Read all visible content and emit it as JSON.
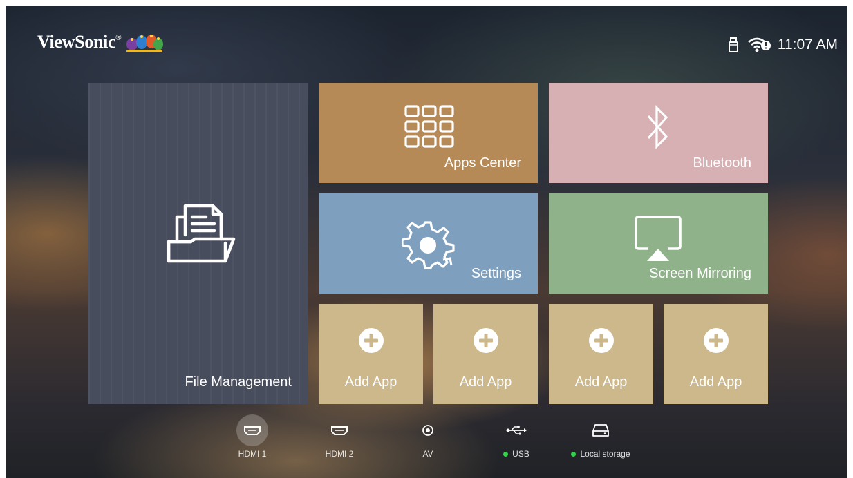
{
  "brand": {
    "name": "ViewSonic",
    "trademark": "®"
  },
  "status": {
    "time": "11:07 AM",
    "icons": [
      "usb-stick-icon",
      "wifi-alert-icon"
    ]
  },
  "tiles": {
    "file_management": {
      "label": "File Management",
      "icon": "folder-document-icon",
      "color": "#484d5d"
    },
    "apps_center": {
      "label": "Apps Center",
      "icon": "grid-icon",
      "color": "#b58a57"
    },
    "bluetooth": {
      "label": "Bluetooth",
      "icon": "bluetooth-icon",
      "color": "#d7b0b4"
    },
    "settings": {
      "label": "Settings",
      "icon": "gear-icon",
      "color": "#7f9fbf"
    },
    "screen_mirroring": {
      "label": "Screen Mirroring",
      "icon": "airplay-icon",
      "color": "#8fb28a"
    },
    "add_apps": [
      {
        "label": "Add App"
      },
      {
        "label": "Add App"
      },
      {
        "label": "Add App"
      },
      {
        "label": "Add App"
      }
    ]
  },
  "inputs": [
    {
      "label": "HDMI 1",
      "icon": "hdmi-icon",
      "active": true,
      "connected": false
    },
    {
      "label": "HDMI 2",
      "icon": "hdmi-icon",
      "active": false,
      "connected": false
    },
    {
      "label": "AV",
      "icon": "av-icon",
      "active": false,
      "connected": false
    },
    {
      "label": "USB",
      "icon": "usb-icon",
      "active": false,
      "connected": true
    },
    {
      "label": "Local storage",
      "icon": "storage-icon",
      "active": false,
      "connected": true
    }
  ],
  "colors": {
    "connected_dot": "#35d04a",
    "add_tile": "#ccb88a"
  }
}
